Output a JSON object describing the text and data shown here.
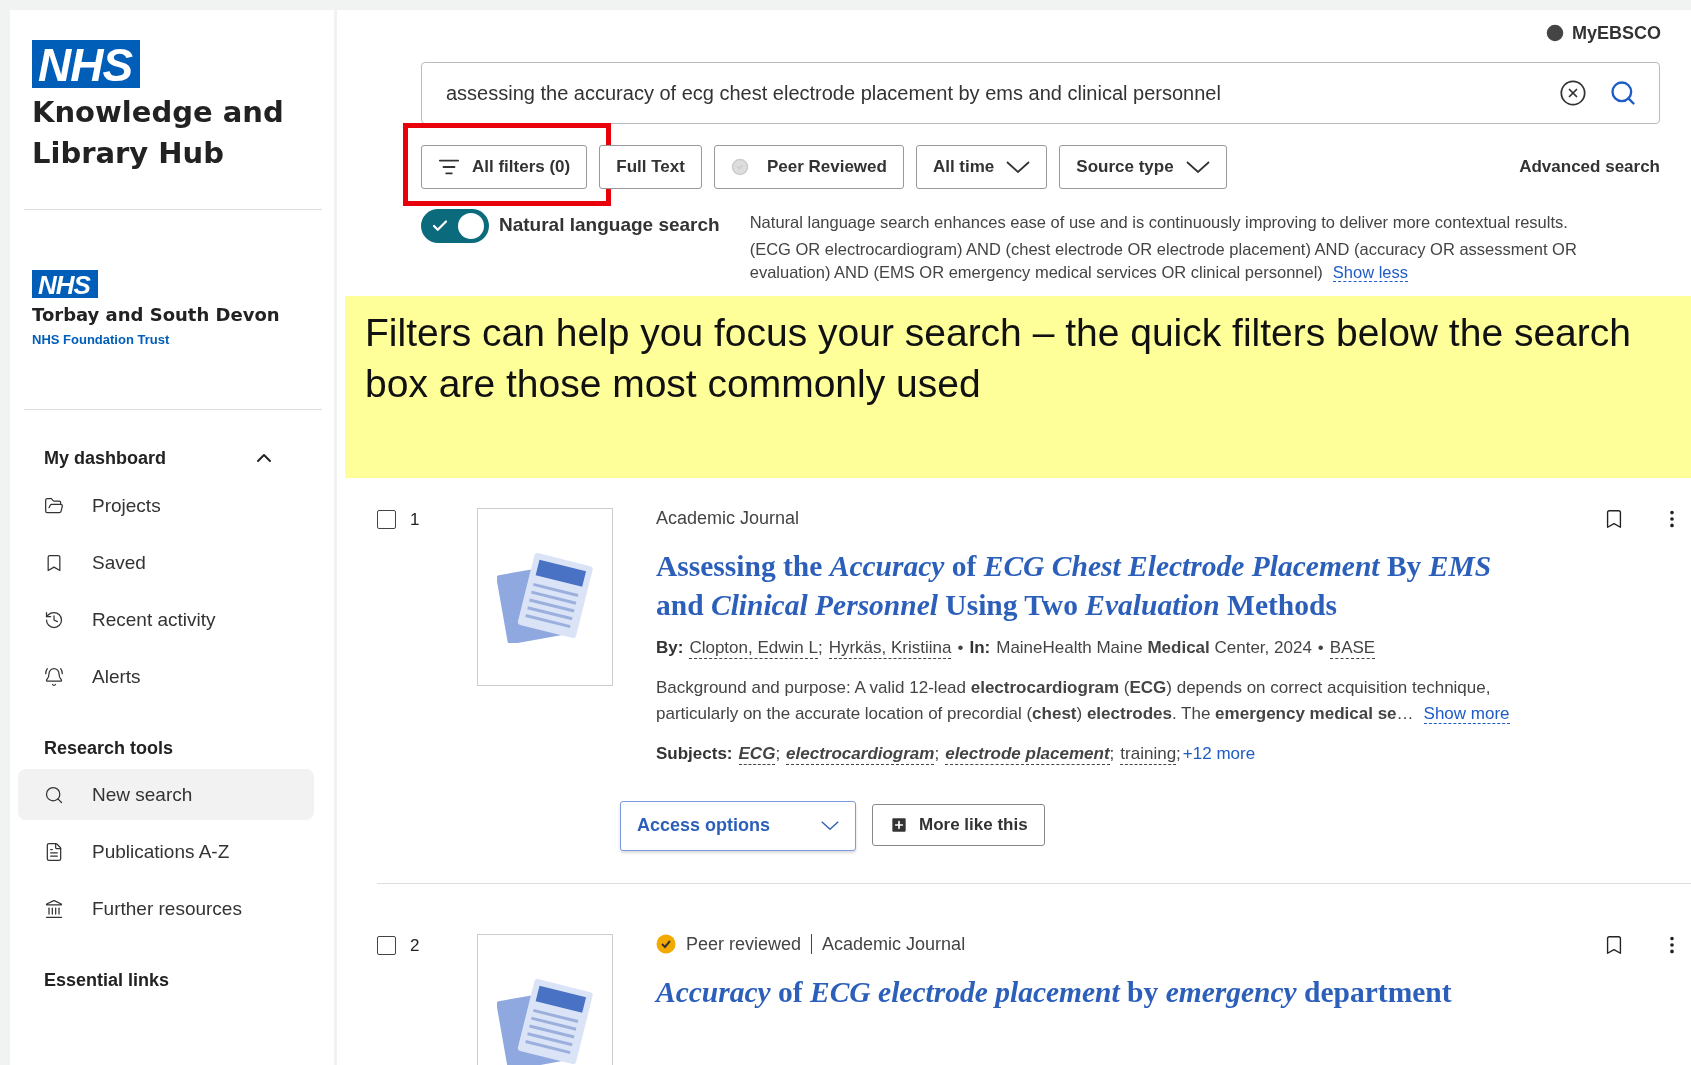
{
  "sidebar": {
    "logo_badge": "NHS",
    "hub_title": "Knowledge and Library Hub",
    "trust": {
      "badge": "NHS",
      "name": "Torbay and South Devon",
      "subtitle": "NHS Foundation Trust"
    },
    "sections": [
      {
        "title": "My dashboard",
        "expanded": true,
        "items": [
          {
            "label": "Projects",
            "kind": "folders",
            "selected": false
          },
          {
            "label": "Saved",
            "kind": "bookmark",
            "selected": false
          },
          {
            "label": "Recent activity",
            "kind": "history",
            "selected": false
          },
          {
            "label": "Alerts",
            "kind": "bell",
            "selected": false
          }
        ]
      },
      {
        "title": "Research tools",
        "items": [
          {
            "label": "New search",
            "kind": "search",
            "selected": true
          },
          {
            "label": "Publications A-Z",
            "kind": "document",
            "selected": false
          },
          {
            "label": "Further resources",
            "kind": "institution",
            "selected": false
          }
        ]
      },
      {
        "title": "Essential links"
      }
    ]
  },
  "account": {
    "label": "MyEBSCO"
  },
  "search": {
    "value": "assessing the accuracy of ecg chest electrode placement by ems and clinical personnel"
  },
  "filters": [
    {
      "kind": "menu",
      "label": "All filters (0)",
      "highlighted": true
    },
    {
      "kind": "plain",
      "label": "Full Text",
      "highlighted": false
    },
    {
      "kind": "check",
      "label": "Peer Reviewed",
      "highlighted": false
    },
    {
      "kind": "dropdown",
      "label": "All time",
      "highlighted": false
    },
    {
      "kind": "dropdown",
      "label": "Source type",
      "highlighted": false
    }
  ],
  "advanced_search": "Advanced search",
  "natural_language": {
    "on": true,
    "label": "Natural language search",
    "description": "Natural language search enhances ease of use and is continuously improving to deliver more contextual results.",
    "query": "(ECG OR electrocardiogram) AND (chest electrode OR electrode placement) AND (accuracy OR assessment OR evaluation) AND (EMS OR emergency medical services OR clinical personnel)",
    "toggle_link": "Show less"
  },
  "callout": {
    "text": "Filters can help you focus your search – the quick filters below the search box are those most commonly used"
  },
  "results": [
    {
      "number": "1",
      "checked": false,
      "peer_reviewed": false,
      "type": "Academic Journal",
      "title": "Assessing the *Accuracy* of *ECG* *Chest* *Electrode* *Placement* By *EMS* and *Clinical* *Personnel* Using Two *Evaluation* Methods",
      "byline": {
        "by_label": "By:",
        "authors": [
          "Clopton, Edwin L",
          "Hyrkäs, Kristiina"
        ],
        "author_separator": ";",
        "in_label": "In:",
        "source": "MaineHealth Maine **Medical** Center, 2024",
        "database": "BASE",
        "bullet": "•"
      },
      "abstract": "Background and purpose: A valid 12-lead **electrocardiogram** (**ECG**) depends on correct acquisition technique, particularly on the accurate location of precordial (**chest**) **electrodes**. The **emergency medical se**…",
      "show_more": "Show more",
      "subjects": {
        "label": "Subjects:",
        "separator": ";",
        "items": [
          {
            "text": "ECG",
            "matched": true
          },
          {
            "text": "electrocardiogram",
            "matched": true
          },
          {
            "text": "electrode placement",
            "matched": true
          },
          {
            "text": "training",
            "matched": false
          }
        ],
        "more": "+12 more"
      },
      "actions": [
        {
          "kind": "dropdown",
          "label": "Access options"
        },
        {
          "kind": "related",
          "label": "More like this"
        }
      ]
    },
    {
      "number": "2",
      "checked": false,
      "peer_reviewed": true,
      "peer_label": "Peer reviewed",
      "type": "Academic Journal",
      "title": "*Accuracy* of *ECG* *electrode* *placement* by *emergency* department"
    }
  ]
}
